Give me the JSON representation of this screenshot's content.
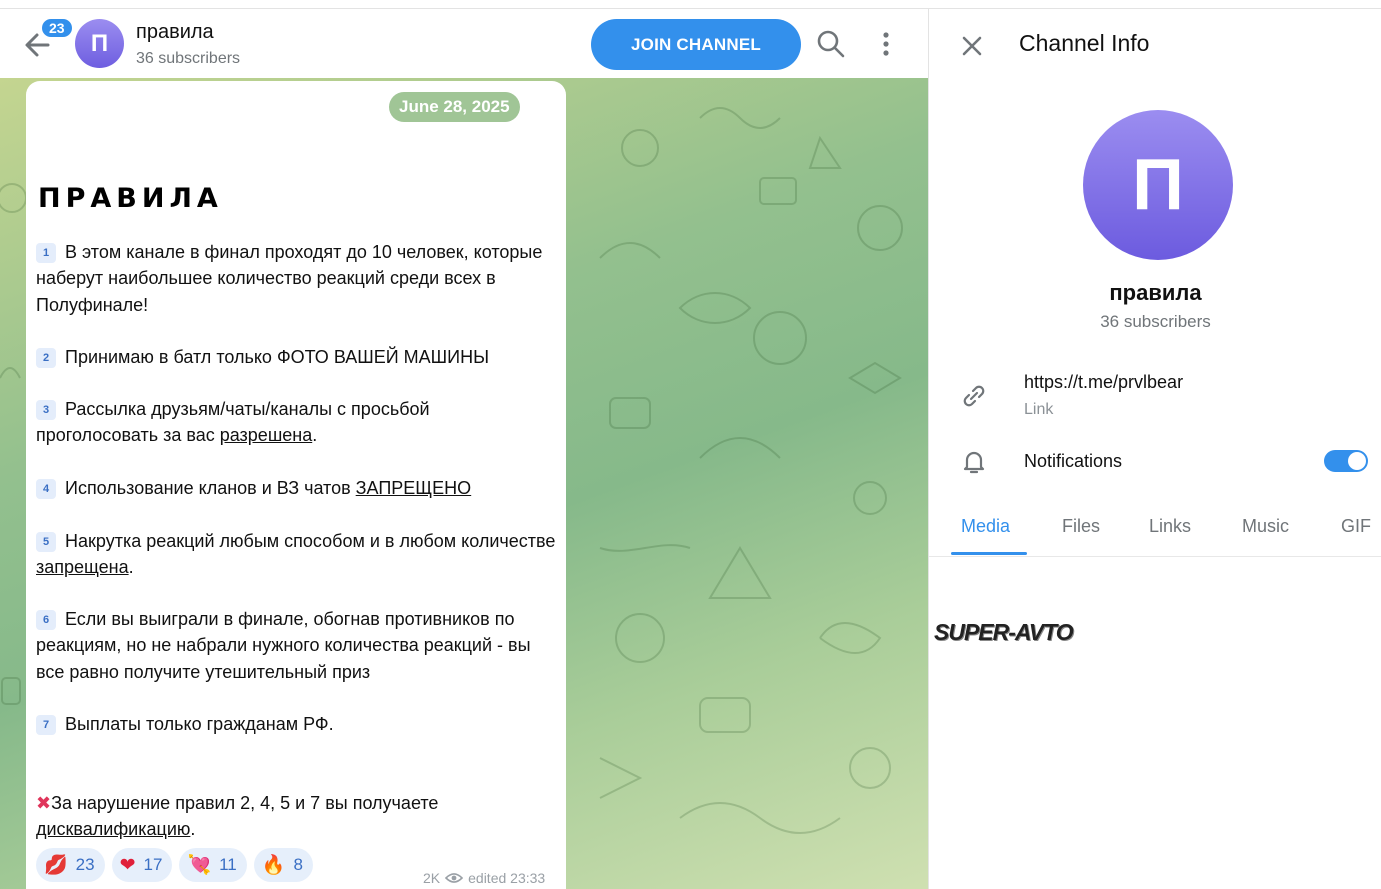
{
  "header": {
    "unread_count": "23",
    "avatar_letter": "П",
    "title": "правила",
    "subtitle": "36 subscribers",
    "join_label": "JOIN CHANNEL"
  },
  "message": {
    "date": "June 28, 2025",
    "title": "ПРАВИЛА",
    "rules": [
      {
        "num": "1",
        "text": "В этом канале в финал проходят до 10 человек, которые наберут наибольшее количество реакций среди всех в Полуфинале!"
      },
      {
        "num": "2",
        "text": "Принимаю в батл только ФОТО ВАШЕЙ МАШИНЫ"
      },
      {
        "num": "3",
        "text": "Рассылка друзьям/чаты/каналы с просьбой проголосовать за вас ",
        "link": "разрешена",
        "tail": "."
      },
      {
        "num": "4",
        "text": "Использование кланов и ВЗ чатов ",
        "link": "ЗАПРЕЩЕНО",
        "tail": ""
      },
      {
        "num": "5",
        "text": "Накрутка реакций любым способом и в любом количестве ",
        "link": "запрещена",
        "tail": "."
      },
      {
        "num": "6",
        "text": "Если вы выиграли в финале, обогнав противников по реакциям, но не набрали нужного количества реакций - вы все равно получите утешительный приз"
      },
      {
        "num": "7",
        "text": "Выплаты только гражданам РФ."
      }
    ],
    "footer_mark": "✖",
    "footer_text": "За нарушение правил 2, 4, 5 и 7 вы получаете ",
    "footer_link": "дисквалификацию",
    "footer_tail": ".",
    "reactions": [
      {
        "emoji": "💋",
        "count": "23"
      },
      {
        "emoji": "❤",
        "count": "17"
      },
      {
        "emoji": "💘",
        "count": "11"
      },
      {
        "emoji": "🔥",
        "count": "8"
      }
    ],
    "views": "2K",
    "edited": "edited 23:33"
  },
  "info": {
    "title": "Channel Info",
    "avatar_letter": "П",
    "name": "правила",
    "subscribers": "36 subscribers",
    "link": "https://t.me/prvlbear",
    "link_label": "Link",
    "notifications_label": "Notifications",
    "notifications_on": true,
    "tabs": [
      "Media",
      "Files",
      "Links",
      "Music",
      "GIF"
    ],
    "active_tab": "Media",
    "media_item": "SUPER-AVTO"
  },
  "colors": {
    "accent": "#3390ec",
    "avatar": "#7b6ce6",
    "reaction_bg": "#e6effb"
  }
}
